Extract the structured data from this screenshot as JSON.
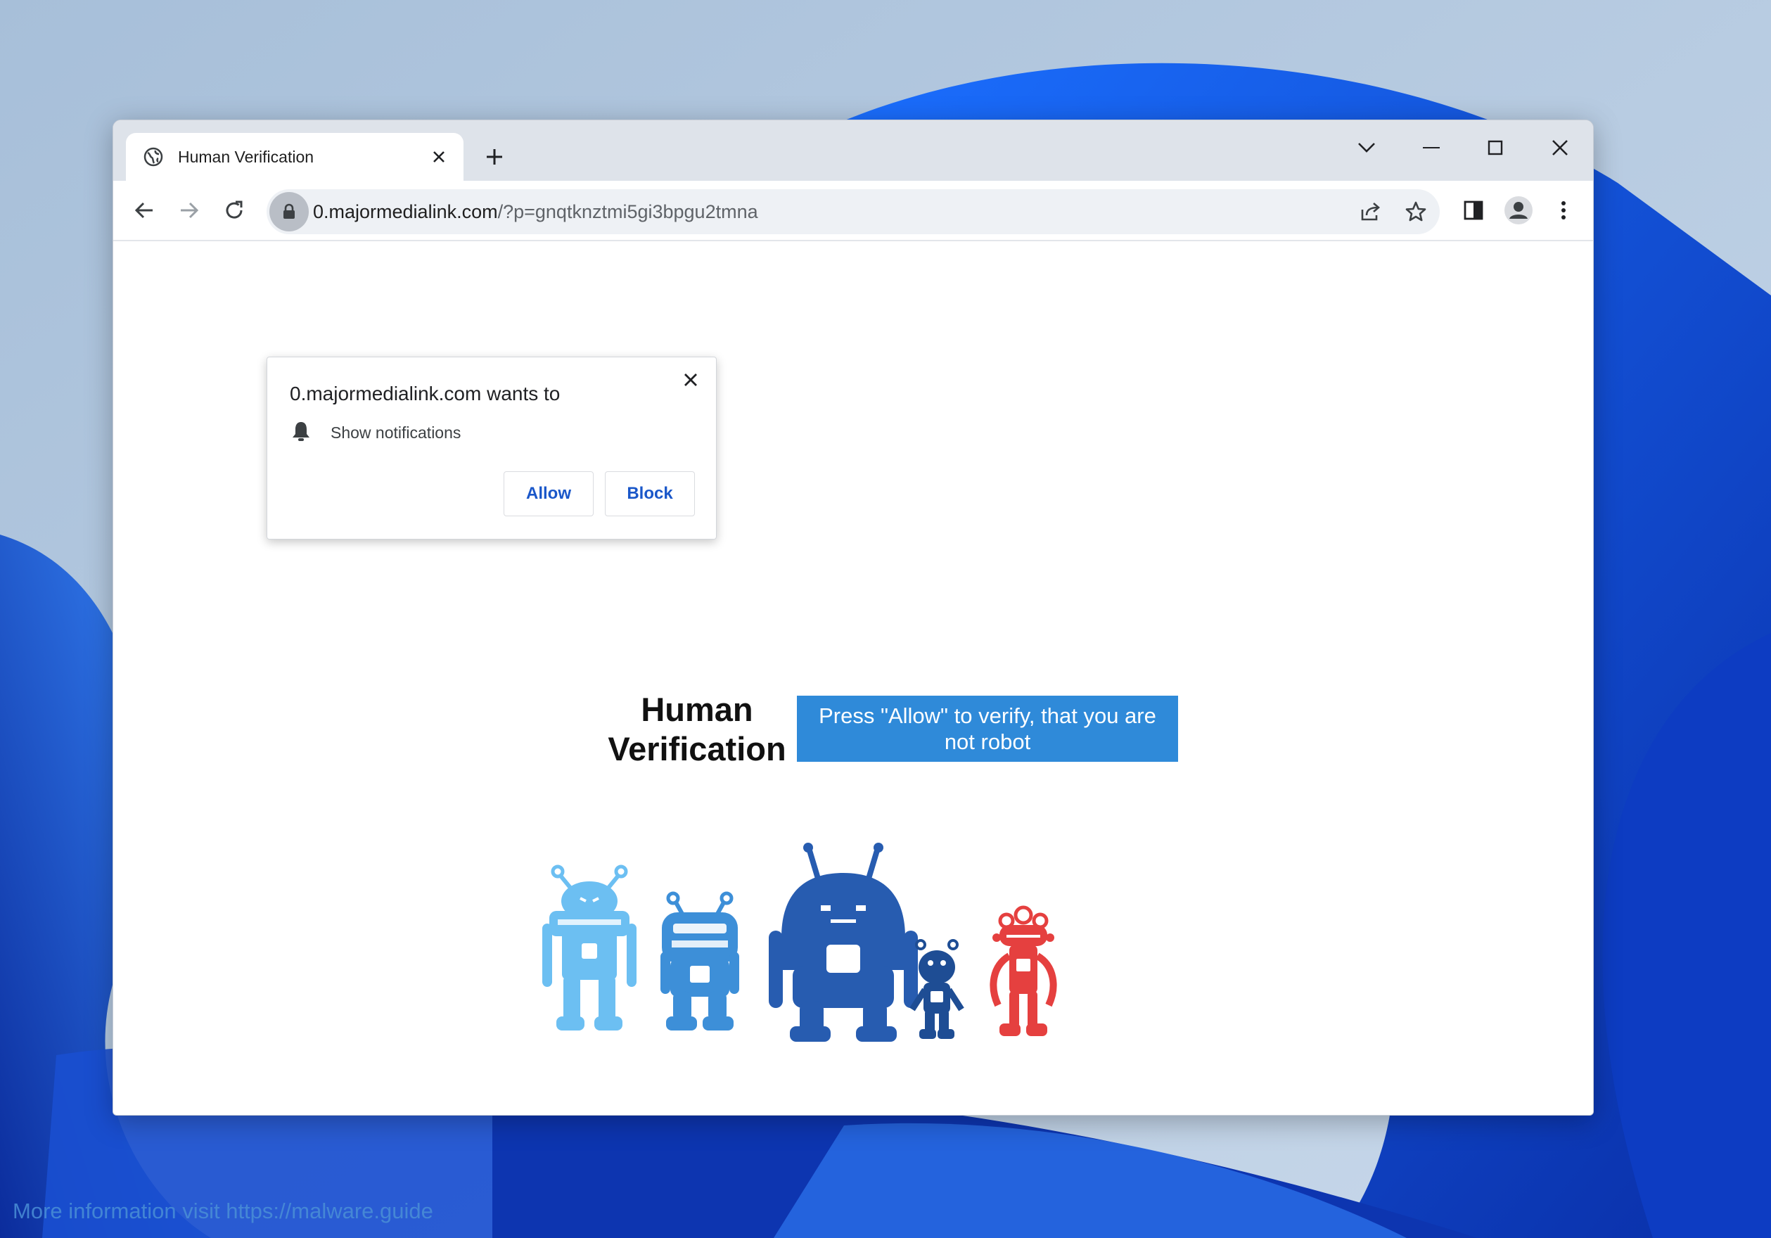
{
  "browser": {
    "tab": {
      "title": "Human Verification",
      "favicon": "globe-icon"
    },
    "address_bar": {
      "host": "0.majormedialink.com",
      "path": "/?p=gnqtknztmi5gi3bpgu2tmna"
    }
  },
  "permission_prompt": {
    "title": "0.majormedialink.com wants to",
    "permission_label": "Show notifications",
    "allow_label": "Allow",
    "block_label": "Block"
  },
  "page": {
    "heading_line1": "Human",
    "heading_line2": "Verification",
    "banner_text": "Press \"Allow\" to verify, that you are not robot",
    "robots": [
      {
        "name": "robot-light-blue",
        "color": "#6cbff2"
      },
      {
        "name": "robot-blue",
        "color": "#3d8fd8"
      },
      {
        "name": "robot-dark-blue",
        "color": "#275cb0"
      },
      {
        "name": "robot-navy",
        "color": "#1e4d94"
      },
      {
        "name": "robot-red",
        "color": "#e5403f"
      }
    ]
  },
  "watermark": "More information visit https://malware.guide",
  "colors": {
    "banner": "#2f8ad9",
    "tabstrip": "#dee3ea",
    "prompt_button_text": "#1a57c9"
  }
}
